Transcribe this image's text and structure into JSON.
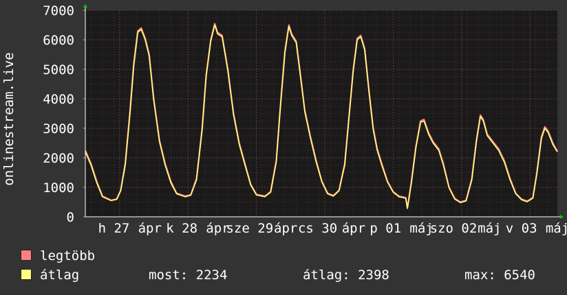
{
  "chart_data": {
    "type": "line",
    "ylabel": "onlinestream.live",
    "ylim": [
      0,
      7000
    ],
    "y_ticks": [
      0,
      1000,
      2000,
      3000,
      4000,
      5000,
      6000,
      7000
    ],
    "x_tick_labels": [
      {
        "label": "h 27",
        "day": 0.42
      },
      {
        "label": "ápr",
        "day": 0.95
      },
      {
        "label": "k 28",
        "day": 1.42
      },
      {
        "label": "ápr",
        "day": 1.95
      },
      {
        "label": "sze 29",
        "day": 2.42
      },
      {
        "label": "ápr",
        "day": 2.95
      },
      {
        "label": "cs 30",
        "day": 3.42
      },
      {
        "label": "ápr",
        "day": 3.95
      },
      {
        "label": "p 01",
        "day": 4.42
      },
      {
        "label": "máj",
        "day": 4.95
      },
      {
        "label": "szo 02",
        "day": 5.42
      },
      {
        "label": "máj",
        "day": 5.95
      },
      {
        "label": "v 03",
        "day": 6.42
      },
      {
        "label": "máj",
        "day": 6.95
      }
    ],
    "grid": true,
    "x_days": 6.95,
    "series": [
      {
        "name": "legtöbb",
        "color": "#ff8080",
        "points": [
          [
            0,
            2250
          ],
          [
            0.1,
            1800
          ],
          [
            0.2,
            1200
          ],
          [
            0.3,
            700
          ],
          [
            0.45,
            560
          ],
          [
            0.55,
            600
          ],
          [
            0.62,
            900
          ],
          [
            0.7,
            1800
          ],
          [
            0.78,
            3500
          ],
          [
            0.85,
            5200
          ],
          [
            0.92,
            6300
          ],
          [
            0.98,
            6400
          ],
          [
            1.05,
            6050
          ],
          [
            1.12,
            5500
          ],
          [
            1.2,
            4000
          ],
          [
            1.3,
            2600
          ],
          [
            1.4,
            1800
          ],
          [
            1.5,
            1200
          ],
          [
            1.6,
            800
          ],
          [
            1.75,
            700
          ],
          [
            1.85,
            750
          ],
          [
            1.95,
            1300
          ],
          [
            2.05,
            3000
          ],
          [
            2.12,
            4800
          ],
          [
            2.2,
            6000
          ],
          [
            2.27,
            6550
          ],
          [
            2.32,
            6250
          ],
          [
            2.4,
            6150
          ],
          [
            2.5,
            5000
          ],
          [
            2.6,
            3500
          ],
          [
            2.7,
            2500
          ],
          [
            2.8,
            1800
          ],
          [
            2.9,
            1100
          ],
          [
            3.0,
            760
          ],
          [
            3.15,
            700
          ],
          [
            3.25,
            850
          ],
          [
            3.35,
            1900
          ],
          [
            3.42,
            3700
          ],
          [
            3.5,
            5600
          ],
          [
            3.57,
            6500
          ],
          [
            3.62,
            6200
          ],
          [
            3.7,
            5950
          ],
          [
            3.78,
            4700
          ],
          [
            3.85,
            3600
          ],
          [
            3.95,
            2700
          ],
          [
            4.05,
            1900
          ],
          [
            4.15,
            1200
          ],
          [
            4.25,
            800
          ],
          [
            4.35,
            720
          ],
          [
            4.45,
            900
          ],
          [
            4.55,
            1800
          ],
          [
            4.62,
            3300
          ],
          [
            4.7,
            5000
          ],
          [
            4.77,
            6050
          ],
          [
            4.83,
            6150
          ],
          [
            4.9,
            5700
          ],
          [
            4.98,
            4200
          ],
          [
            5.05,
            3000
          ],
          [
            5.12,
            2300
          ],
          [
            5.2,
            1800
          ],
          [
            5.3,
            1200
          ],
          [
            5.4,
            850
          ],
          [
            5.5,
            700
          ],
          [
            5.62,
            650
          ],
          [
            5.65,
            300
          ],
          [
            5.72,
            1200
          ],
          [
            5.8,
            2400
          ],
          [
            5.88,
            3250
          ],
          [
            5.94,
            3300
          ],
          [
            6.02,
            2850
          ],
          [
            6.1,
            2550
          ],
          [
            6.2,
            2300
          ],
          [
            6.28,
            1800
          ],
          [
            6.38,
            1000
          ],
          [
            6.48,
            620
          ],
          [
            6.58,
            500
          ],
          [
            6.68,
            560
          ],
          [
            6.78,
            1300
          ],
          [
            6.86,
            2600
          ],
          [
            6.93,
            3450
          ],
          [
            6.98,
            3300
          ],
          [
            7.05,
            2800
          ],
          [
            7.15,
            2550
          ],
          [
            7.25,
            2300
          ],
          [
            7.35,
            1900
          ],
          [
            7.45,
            1300
          ],
          [
            7.55,
            800
          ],
          [
            7.65,
            600
          ],
          [
            7.75,
            530
          ],
          [
            7.85,
            650
          ],
          [
            7.92,
            1500
          ],
          [
            8.0,
            2700
          ],
          [
            8.06,
            3050
          ],
          [
            8.12,
            2900
          ],
          [
            8.2,
            2500
          ],
          [
            8.28,
            2220
          ]
        ]
      },
      {
        "name": "átlag",
        "color": "#ffff80",
        "points": [
          [
            0,
            2200
          ],
          [
            0.1,
            1750
          ],
          [
            0.2,
            1150
          ],
          [
            0.3,
            680
          ],
          [
            0.45,
            550
          ],
          [
            0.55,
            590
          ],
          [
            0.62,
            880
          ],
          [
            0.7,
            1750
          ],
          [
            0.78,
            3400
          ],
          [
            0.85,
            5100
          ],
          [
            0.92,
            6250
          ],
          [
            0.98,
            6350
          ],
          [
            1.05,
            6000
          ],
          [
            1.12,
            5450
          ],
          [
            1.2,
            3950
          ],
          [
            1.3,
            2550
          ],
          [
            1.4,
            1750
          ],
          [
            1.5,
            1150
          ],
          [
            1.6,
            780
          ],
          [
            1.75,
            680
          ],
          [
            1.85,
            730
          ],
          [
            1.95,
            1250
          ],
          [
            2.05,
            2950
          ],
          [
            2.12,
            4750
          ],
          [
            2.2,
            5950
          ],
          [
            2.27,
            6500
          ],
          [
            2.32,
            6200
          ],
          [
            2.4,
            6100
          ],
          [
            2.5,
            4950
          ],
          [
            2.6,
            3450
          ],
          [
            2.7,
            2450
          ],
          [
            2.8,
            1750
          ],
          [
            2.9,
            1080
          ],
          [
            3.0,
            740
          ],
          [
            3.15,
            680
          ],
          [
            3.25,
            830
          ],
          [
            3.35,
            1850
          ],
          [
            3.42,
            3650
          ],
          [
            3.5,
            5550
          ],
          [
            3.57,
            6450
          ],
          [
            3.62,
            6150
          ],
          [
            3.7,
            5900
          ],
          [
            3.78,
            4650
          ],
          [
            3.85,
            3550
          ],
          [
            3.95,
            2650
          ],
          [
            4.05,
            1850
          ],
          [
            4.15,
            1180
          ],
          [
            4.25,
            780
          ],
          [
            4.35,
            700
          ],
          [
            4.45,
            880
          ],
          [
            4.55,
            1750
          ],
          [
            4.62,
            3250
          ],
          [
            4.7,
            4950
          ],
          [
            4.77,
            6000
          ],
          [
            4.83,
            6100
          ],
          [
            4.9,
            5650
          ],
          [
            4.98,
            4150
          ],
          [
            5.05,
            2950
          ],
          [
            5.12,
            2250
          ],
          [
            5.2,
            1750
          ],
          [
            5.3,
            1180
          ],
          [
            5.4,
            830
          ],
          [
            5.5,
            680
          ],
          [
            5.62,
            630
          ],
          [
            5.65,
            280
          ],
          [
            5.72,
            1150
          ],
          [
            5.8,
            2350
          ],
          [
            5.88,
            3200
          ],
          [
            5.94,
            3250
          ],
          [
            6.02,
            2800
          ],
          [
            6.1,
            2500
          ],
          [
            6.2,
            2250
          ],
          [
            6.28,
            1750
          ],
          [
            6.38,
            980
          ],
          [
            6.48,
            600
          ],
          [
            6.58,
            480
          ],
          [
            6.68,
            540
          ],
          [
            6.78,
            1250
          ],
          [
            6.86,
            2550
          ],
          [
            6.93,
            3400
          ],
          [
            6.98,
            3250
          ],
          [
            7.05,
            2750
          ],
          [
            7.15,
            2500
          ],
          [
            7.25,
            2250
          ],
          [
            7.35,
            1850
          ],
          [
            7.45,
            1250
          ],
          [
            7.55,
            780
          ],
          [
            7.65,
            580
          ],
          [
            7.75,
            510
          ],
          [
            7.85,
            630
          ],
          [
            7.92,
            1450
          ],
          [
            8.0,
            2650
          ],
          [
            8.06,
            3000
          ],
          [
            8.12,
            2850
          ],
          [
            8.2,
            2450
          ],
          [
            8.28,
            2200
          ]
        ]
      }
    ]
  },
  "legend": {
    "items": [
      {
        "label": "legtöbb",
        "color": "#ff8080"
      },
      {
        "label": "átlag",
        "color": "#ffff80"
      }
    ],
    "stats": {
      "most_label": "most:",
      "most_value": "2234",
      "atlag_label": "átlag:",
      "atlag_value": "2398",
      "max_label": "max:",
      "max_value": "6540"
    }
  },
  "colors": {
    "background": "#333333",
    "plot_background": "#1a1a1a",
    "grid": "#6a3a3a",
    "axis": "#ffffff",
    "arrow": "#00cc00"
  }
}
